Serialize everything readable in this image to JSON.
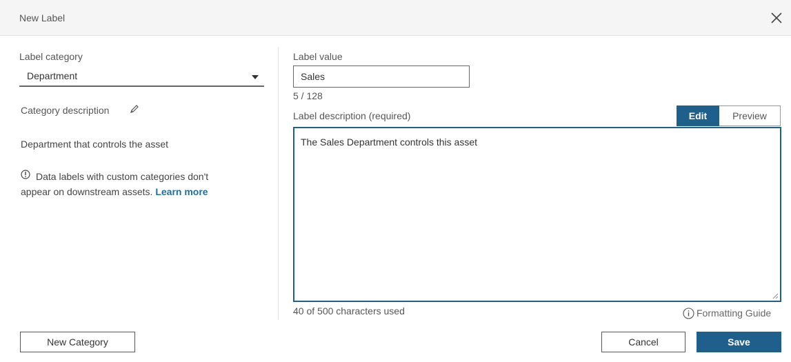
{
  "dialog": {
    "title": "New Label",
    "close_icon": "close-icon"
  },
  "left": {
    "category_label": "Label category",
    "category_value": "Department",
    "category_description_label": "Category description",
    "category_description": "Department that controls the asset",
    "info_line1": "Data labels with custom categories don't",
    "info_line2": "appear on downstream assets.",
    "learn_more": "Learn more"
  },
  "right": {
    "value_label": "Label value",
    "value": "Sales",
    "value_counter": "5 / 128",
    "description_label": "Label description (required)",
    "tabs": {
      "edit": "Edit",
      "preview": "Preview"
    },
    "description_text": "The Sales Department controls this asset",
    "char_count": "40 of 500 characters used",
    "formatting_guide": "Formatting Guide"
  },
  "footer": {
    "new_category": "New Category",
    "cancel": "Cancel",
    "save": "Save"
  },
  "colors": {
    "accent": "#1f5f8b",
    "link": "#1f6fa0",
    "header_bg": "#f5f5f5"
  }
}
